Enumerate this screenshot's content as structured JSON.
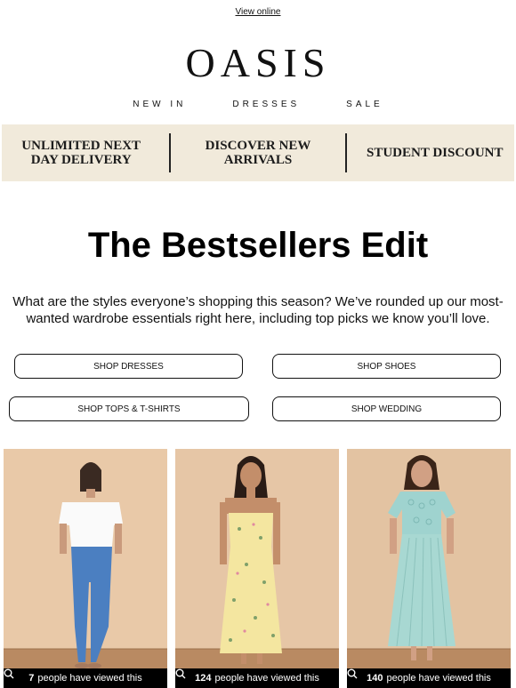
{
  "header": {
    "view_online": "View online",
    "logo": "OASIS",
    "nav": [
      "NEW IN",
      "DRESSES",
      "SALE"
    ]
  },
  "banner": {
    "items": [
      "UNLIMITED NEXT DAY DELIVERY",
      "DISCOVER NEW ARRIVALS",
      "STUDENT DISCOUNT"
    ]
  },
  "main": {
    "headline": "The Bestsellers Edit",
    "intro": "What are the styles everyone’s shopping this season? We’ve rounded up our most-wanted wardrobe essentials right here, including top picks we know you’ll love.",
    "buttons": [
      "SHOP DRESSES",
      "SHOP SHOES",
      "SHOP TOPS & T-SHIRTS",
      "SHOP WEDDING"
    ]
  },
  "products": [
    {
      "count": "7",
      "text": "people have viewed this",
      "desc": "white t-shirt and blue skinny jeans"
    },
    {
      "count": "124",
      "text": "people have viewed this",
      "desc": "yellow floral midi dress"
    },
    {
      "count": "140",
      "text": "people have viewed this",
      "desc": "sage green lace pleated midi dress"
    }
  ],
  "colors": {
    "banner_bg": "#f1eadb",
    "product_bg": "#e9c9a8",
    "viewed_bar": "#000000"
  },
  "icons": {
    "viewed": "search-icon"
  }
}
